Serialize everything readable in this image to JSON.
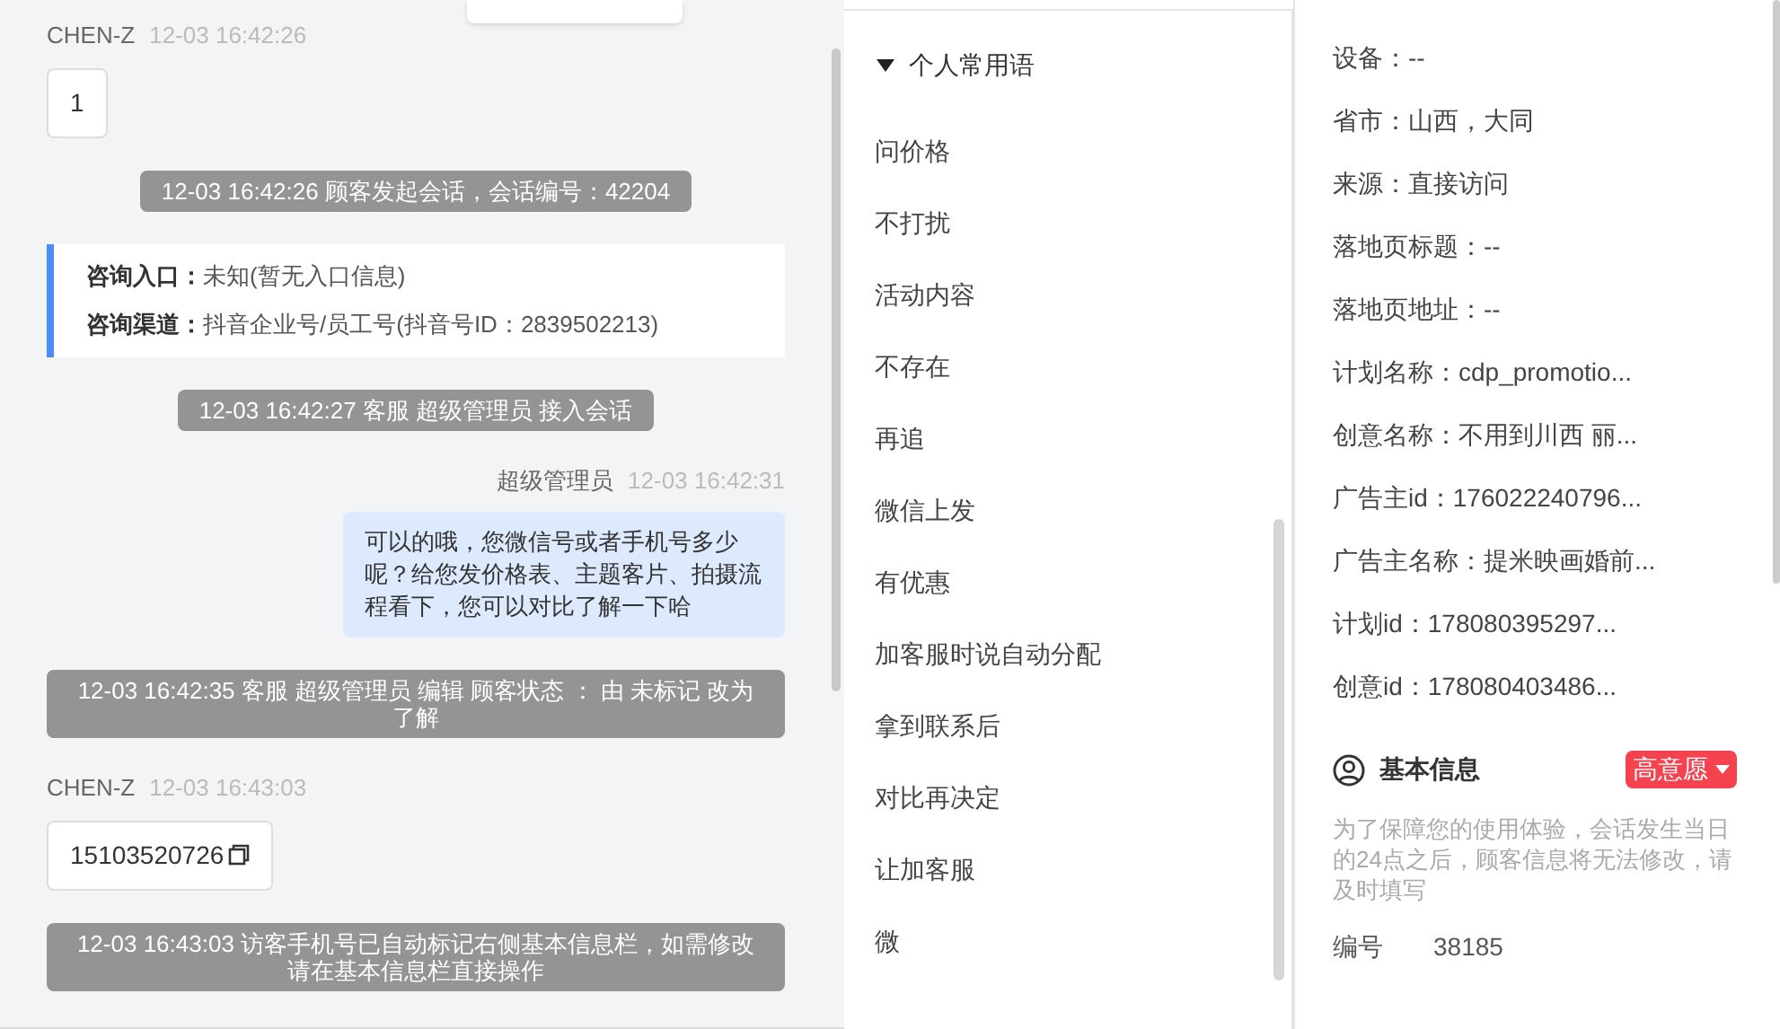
{
  "chat": [
    {
      "kind": "customer",
      "name": "CHEN-Z",
      "time": "12-03 16:42:26",
      "text": "1"
    },
    {
      "kind": "system",
      "text": "12-03 16:42:26 顾客发起会话，会话编号：42204"
    },
    {
      "kind": "info",
      "rows": [
        {
          "label": "咨询入口：",
          "value": "未知(暂无入口信息)"
        },
        {
          "label": "咨询渠道：",
          "value": "抖音企业号/员工号(抖音号ID：2839502213)"
        }
      ]
    },
    {
      "kind": "system",
      "text": "12-03 16:42:27 客服 超级管理员 接入会话"
    },
    {
      "kind": "agent",
      "name": "超级管理员",
      "time": "12-03 16:42:31",
      "text": "可以的哦，您微信号或者手机号多少呢？给您发价格表、主题客片、拍摄流程看下，您可以对比了解一下哈"
    },
    {
      "kind": "system",
      "text": "12-03 16:42:35 客服 超级管理员 编辑 顾客状态 ： 由 未标记 改为了解"
    },
    {
      "kind": "customer",
      "name": "CHEN-Z",
      "time": "12-03 16:43:03",
      "text": "15103520726",
      "copyable": true
    },
    {
      "kind": "system",
      "text": "12-03 16:43:03 访客手机号已自动标记右侧基本信息栏，如需修改请在基本信息栏直接操作"
    }
  ],
  "phrases": {
    "group": "个人常用语",
    "expanded": true,
    "items": [
      "问价格",
      "不打扰",
      "活动内容",
      "不存在",
      "再追",
      "微信上发",
      "有优惠",
      "加客服时说自动分配",
      "拿到联系后",
      "对比再决定",
      "让加客服",
      "微"
    ]
  },
  "details": [
    "设备：--",
    "省市：山西，大同",
    "来源：直接访问",
    "落地页标题：--",
    "落地页地址：--",
    "计划名称：cdp_promotio...",
    "创意名称：不用到川西 丽...",
    "广告主id：176022240796...",
    "广告主名称：提米映画婚前...",
    "计划id：178080395297...",
    "创意id：178080403486..."
  ],
  "basic_info": {
    "title": "基本信息",
    "intent": "高意愿",
    "notice": "为了保障您的使用体验，会话发生当日的24点之后，顾客信息将无法修改，请及时填写",
    "fields": [
      {
        "label": "编号",
        "value": "38185"
      }
    ]
  }
}
